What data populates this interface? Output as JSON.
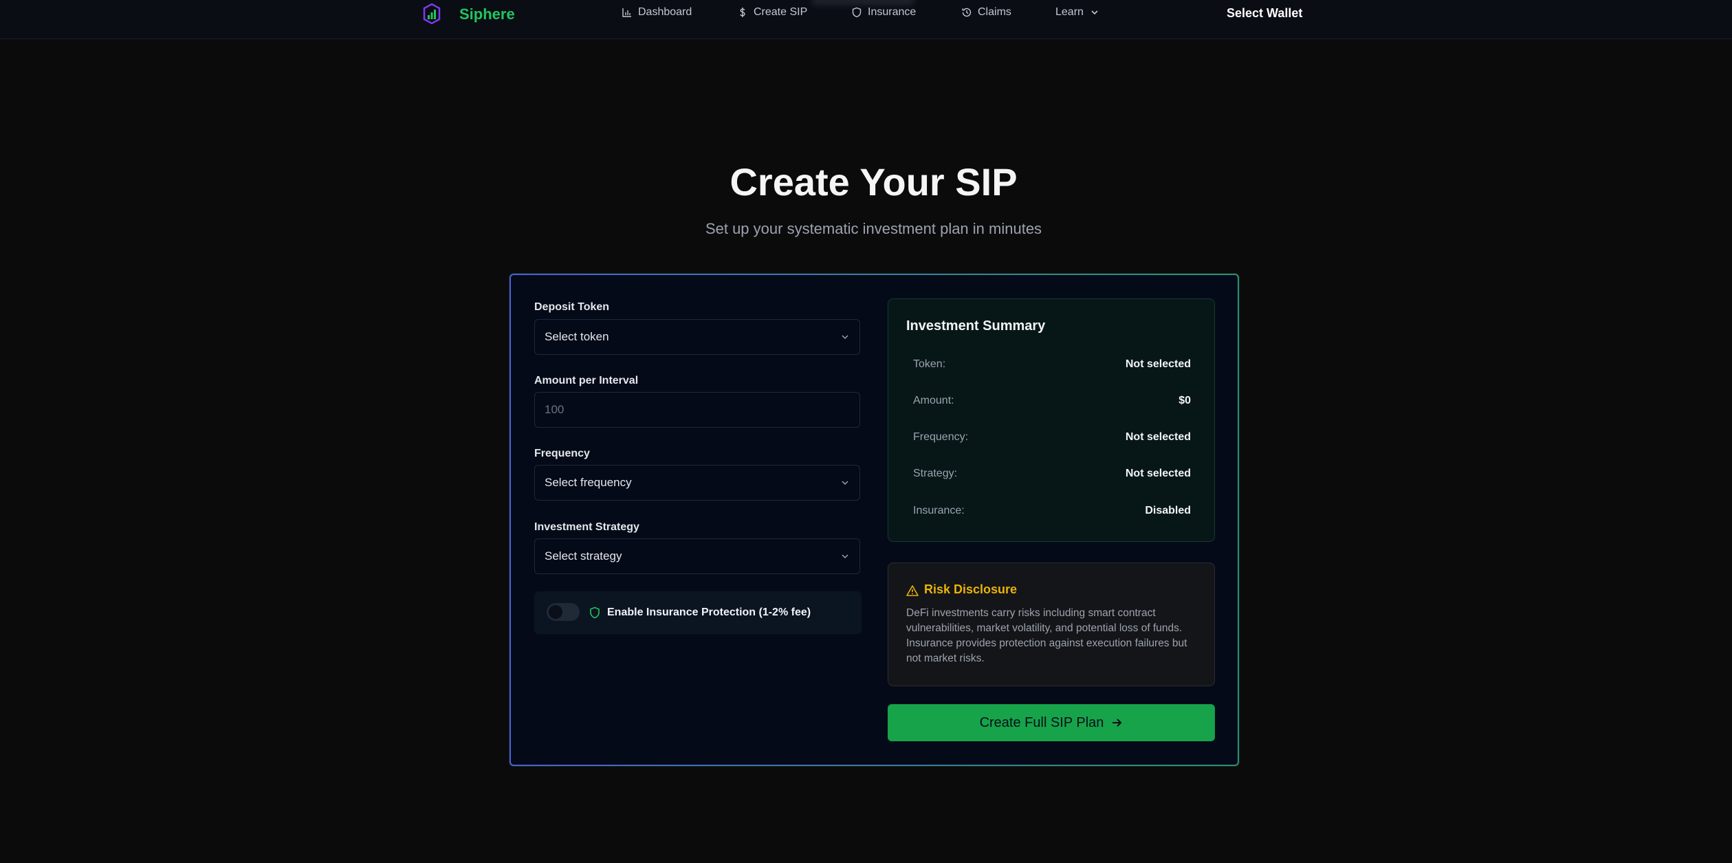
{
  "header": {
    "brand": "Siphere",
    "nav": [
      {
        "label": "Dashboard",
        "icon": "bar-chart-icon"
      },
      {
        "label": "Create SIP",
        "icon": "dollar-icon"
      },
      {
        "label": "Insurance",
        "icon": "shield-icon"
      },
      {
        "label": "Claims",
        "icon": "history-icon"
      },
      {
        "label": "Learn",
        "icon": "chevron-down-icon"
      }
    ],
    "wallet_label": "Select Wallet"
  },
  "page": {
    "title": "Create Your SIP",
    "subtitle": "Set up your systematic investment plan in minutes"
  },
  "form": {
    "deposit_token": {
      "label": "Deposit Token",
      "value": "Select token"
    },
    "amount": {
      "label": "Amount per Interval",
      "placeholder": "100"
    },
    "frequency": {
      "label": "Frequency",
      "value": "Select frequency"
    },
    "strategy": {
      "label": "Investment Strategy",
      "value": "Select strategy"
    },
    "insurance_toggle": {
      "label": "Enable Insurance Protection (1-2% fee)"
    }
  },
  "summary": {
    "title": "Investment Summary",
    "rows": [
      {
        "key": "Token:",
        "value": "Not selected"
      },
      {
        "key": "Amount:",
        "value": "$0"
      },
      {
        "key": "Frequency:",
        "value": "Not selected"
      },
      {
        "key": "Strategy:",
        "value": "Not selected"
      },
      {
        "key": "Insurance:",
        "value": "Disabled"
      }
    ]
  },
  "risk": {
    "title": "Risk Disclosure",
    "text": "DeFi investments carry risks including smart contract vulnerabilities, market volatility, and potential loss of funds. Insurance provides protection against execution failures but not market risks."
  },
  "cta_label": "Create Full SIP Plan",
  "colors": {
    "accent": "#22c55e",
    "button": "#16a34a",
    "warning": "#eab308"
  }
}
